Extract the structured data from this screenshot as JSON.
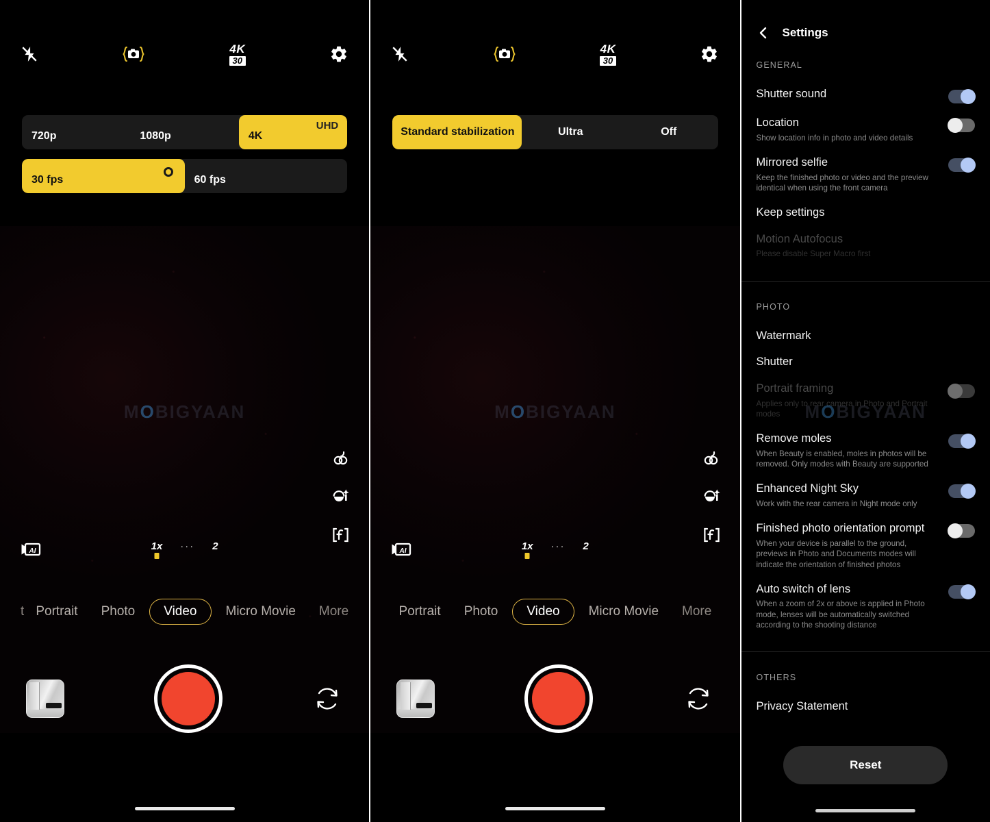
{
  "panels": {
    "left": {
      "topbar": {
        "flash_icon": "flash-off-icon",
        "hdr_icon": "bracketed-camera-icon",
        "resolution_badge": {
          "quality": "4K",
          "fps": "30"
        },
        "settings_icon": "gear-icon"
      },
      "resolution_options": [
        {
          "label": "720p",
          "selected": false,
          "corner": ""
        },
        {
          "label": "1080p",
          "selected": false,
          "corner": ""
        },
        {
          "label": "4K",
          "selected": true,
          "corner": "UHD"
        }
      ],
      "fps_options": [
        {
          "label": "30 fps",
          "selected": true
        },
        {
          "label": "60 fps",
          "selected": false
        }
      ],
      "watermark": "MOBIGYAAN",
      "rail_icons": [
        "color-filter-icon",
        "beauty-face-icon",
        "filter-f-icon"
      ],
      "ai_icon": "video-ai-icon",
      "zoom": {
        "levels": [
          "1x",
          "···",
          "2"
        ],
        "active": "1x"
      },
      "modes": [
        {
          "label": "t",
          "selected": false,
          "edge": true
        },
        {
          "label": "Portrait",
          "selected": false
        },
        {
          "label": "Photo",
          "selected": false
        },
        {
          "label": "Video",
          "selected": true
        },
        {
          "label": "Micro Movie",
          "selected": false
        },
        {
          "label": "More",
          "selected": false,
          "edge": true
        }
      ],
      "bottom": {
        "gallery_thumbnail": "gallery-thumbnail",
        "record_button": "record-button",
        "flip_camera": "flip-camera-icon"
      }
    },
    "middle": {
      "topbar": {
        "flash_icon": "flash-off-icon",
        "hdr_icon": "bracketed-camera-icon",
        "resolution_badge": {
          "quality": "4K",
          "fps": "30"
        },
        "settings_icon": "gear-icon"
      },
      "stabilization_options": [
        {
          "label": "Standard stabilization",
          "selected": true
        },
        {
          "label": "Ultra",
          "selected": false
        },
        {
          "label": "Off",
          "selected": false
        }
      ],
      "watermark": "MOBIGYAAN",
      "zoom": {
        "levels": [
          "1x",
          "···",
          "2"
        ],
        "active": "1x"
      },
      "modes": [
        {
          "label": "Portrait",
          "selected": false
        },
        {
          "label": "Photo",
          "selected": false
        },
        {
          "label": "Video",
          "selected": true
        },
        {
          "label": "Micro Movie",
          "selected": false
        },
        {
          "label": "More",
          "selected": false,
          "edge": true
        }
      ]
    },
    "settings": {
      "header": {
        "back_icon": "back-chevron-icon",
        "title": "Settings"
      },
      "watermark": "MOBIGYAAN",
      "sections": [
        {
          "title": "GENERAL",
          "items": [
            {
              "name": "Shutter sound",
              "desc": "",
              "toggle": "on"
            },
            {
              "name": "Location",
              "desc": "Show location info in photo and video details",
              "toggle": "off"
            },
            {
              "name": "Mirrored selfie",
              "desc": "Keep the finished photo or video and the preview identical when using the front camera",
              "toggle": "on"
            },
            {
              "name": "Keep settings",
              "desc": "",
              "toggle": "none"
            },
            {
              "name": "Motion Autofocus",
              "desc": "Please disable Super Macro first",
              "toggle": "none",
              "disabled": true
            }
          ]
        },
        {
          "title": "PHOTO",
          "items": [
            {
              "name": "Watermark",
              "desc": "",
              "toggle": "none"
            },
            {
              "name": "Shutter",
              "desc": "",
              "toggle": "none"
            },
            {
              "name": "Portrait framing",
              "desc": "Applies only to rear camera in Photo and Portrait modes",
              "toggle": "dim",
              "disabled": true
            },
            {
              "name": "Remove moles",
              "desc": "When Beauty is enabled, moles in photos will be removed. Only modes with Beauty are supported",
              "toggle": "on"
            },
            {
              "name": "Enhanced Night Sky",
              "desc": "Work with the rear camera in Night mode only",
              "toggle": "on"
            },
            {
              "name": "Finished photo orientation prompt",
              "desc": "When your device is parallel to the ground, previews in Photo and Documents modes will indicate the orientation of finished photos",
              "toggle": "off"
            },
            {
              "name": "Auto switch of lens",
              "desc": "When a zoom of 2x or above is applied in Photo mode, lenses will be automatically switched according to the shooting distance",
              "toggle": "on"
            }
          ]
        },
        {
          "title": "OTHERS",
          "items": [
            {
              "name": "Privacy Statement",
              "desc": "",
              "toggle": "none"
            }
          ]
        }
      ],
      "reset_label": "Reset"
    }
  },
  "colors": {
    "accent_yellow": "#f2cb2e",
    "record_red": "#f1452e",
    "toggle_on": "#b3c9f5",
    "mode_selected_border": "#e0b646"
  }
}
